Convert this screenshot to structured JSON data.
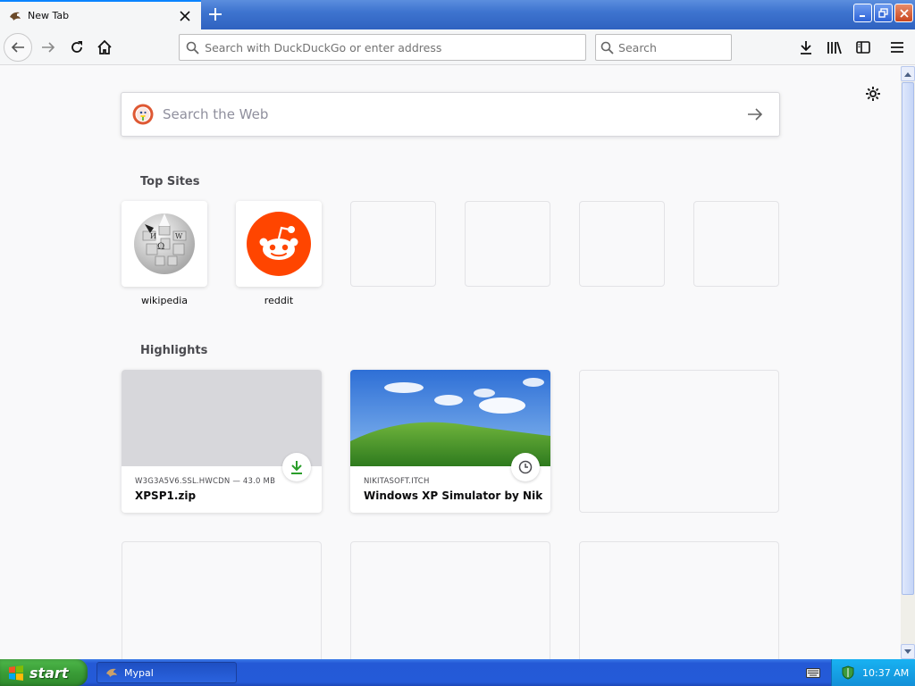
{
  "browser": {
    "tab": {
      "title": "New Tab"
    },
    "nav": {
      "address_placeholder": "Search with DuckDuckGo or enter address",
      "search_placeholder": "Search"
    }
  },
  "newtab": {
    "web_search": {
      "placeholder": "Search the Web"
    },
    "top_sites": {
      "title": "Top Sites",
      "sites": [
        {
          "label": "wikipedia",
          "icon": "wikipedia-globe-icon"
        },
        {
          "label": "reddit",
          "icon": "reddit-alien-icon"
        },
        {
          "label": ""
        },
        {
          "label": ""
        },
        {
          "label": ""
        },
        {
          "label": ""
        }
      ]
    },
    "highlights": {
      "title": "Highlights",
      "cards": [
        {
          "host": "W3G3A5V6.SSL.HWCDN — 43.0 MB",
          "title": "XPSP1.zip",
          "badge": "download-icon"
        },
        {
          "host": "NIKITASOFT.ITCH",
          "title": "Windows XP Simulator by Nikita...",
          "badge": "clock-icon"
        }
      ]
    }
  },
  "taskbar": {
    "start_label": "start",
    "task_item": "Mypal",
    "clock": "10:37 AM"
  },
  "colors": {
    "accent": "#0a84ff",
    "reddit": "#ff4500",
    "download_green": "#2a9d2a"
  }
}
